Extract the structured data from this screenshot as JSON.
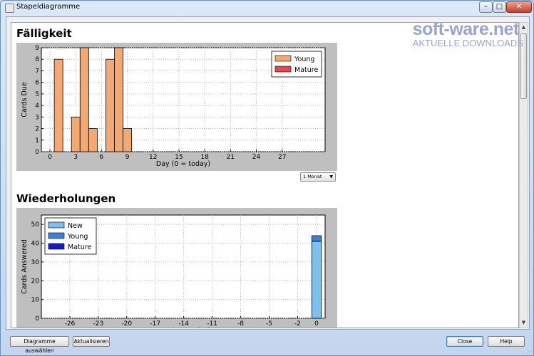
{
  "window": {
    "title": "Stapeldiagramme",
    "min_glyph": "–",
    "max_glyph": "□",
    "close_glyph": "✕"
  },
  "watermark": {
    "brand": "soft-ware.net",
    "tagline": "AKTUELLE DOWNLOADS"
  },
  "sections": {
    "due_title": "Fälligkeit",
    "reviews_title": "Wiederholungen"
  },
  "period_select": {
    "value": "1 Monat"
  },
  "buttons": {
    "select_charts": "Diagramme auswählen",
    "refresh": "Aktualisieren",
    "close": "Close",
    "help": "Help"
  },
  "chart_data": [
    {
      "type": "bar",
      "xlabel": "Day (0 = today)",
      "ylabel": "Cards Due",
      "xlim": [
        -1,
        32
      ],
      "ylim": [
        0,
        9
      ],
      "xticks": [
        0,
        3,
        6,
        9,
        12,
        15,
        18,
        21,
        24,
        27
      ],
      "yticks": [
        0,
        1,
        2,
        3,
        4,
        5,
        6,
        7,
        8,
        9
      ],
      "grid": true,
      "legend_position": "top-right",
      "x": [
        1,
        3,
        4,
        5,
        7,
        8,
        9
      ],
      "series": [
        {
          "name": "Young",
          "color": "#f5a86f",
          "values": [
            8,
            3,
            9,
            2,
            8,
            9,
            2
          ]
        },
        {
          "name": "Mature",
          "color": "#e44a4a",
          "values": [
            0,
            0,
            0,
            0,
            0,
            0,
            0
          ]
        }
      ]
    },
    {
      "type": "bar",
      "xlabel": "Day (0 = today)",
      "ylabel": "Cards Answered",
      "xlim": [
        -29,
        0.9
      ],
      "ylim": [
        0,
        55
      ],
      "xticks": [
        -26,
        -23,
        -20,
        -17,
        -14,
        -11,
        -8,
        -5,
        -2,
        0
      ],
      "yticks": [
        0,
        10,
        20,
        30,
        40,
        50
      ],
      "grid": true,
      "legend_position": "top-left",
      "x": [
        0
      ],
      "series": [
        {
          "name": "New",
          "color": "#7ec0f0",
          "values": [
            41
          ]
        },
        {
          "name": "Young",
          "color": "#3c7de0",
          "values": [
            3
          ]
        },
        {
          "name": "Mature",
          "color": "#1a1acc",
          "values": [
            0
          ]
        }
      ]
    }
  ]
}
